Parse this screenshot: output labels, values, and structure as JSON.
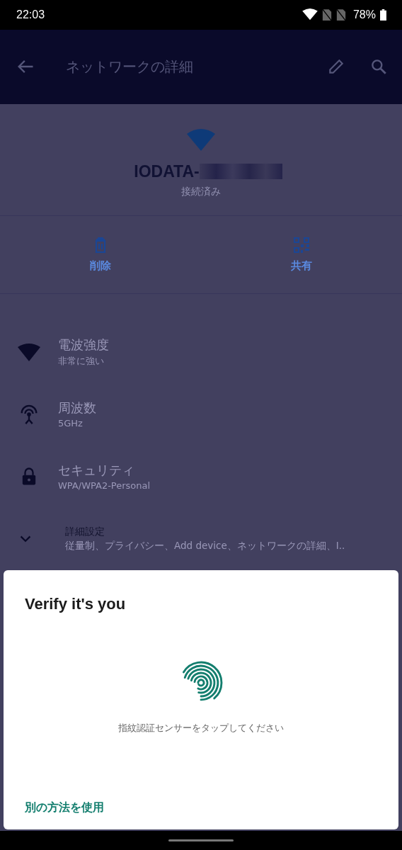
{
  "status_bar": {
    "time": "22:03",
    "battery": "78%"
  },
  "app_bar": {
    "title": "ネットワークの詳細"
  },
  "network": {
    "ssid": "IODATA-",
    "status": "接続済み"
  },
  "actions": [
    {
      "kind": "delete",
      "label": "削除"
    },
    {
      "kind": "share",
      "label": "共有"
    }
  ],
  "details": [
    {
      "kind": "signal",
      "title": "電波強度",
      "value": "非常に強い"
    },
    {
      "kind": "frequency",
      "title": "周波数",
      "value": "5GHz"
    },
    {
      "kind": "security",
      "title": "セキュリティ",
      "value": "WPA/WPA2-Personal"
    },
    {
      "kind": "advanced",
      "title": "詳細設定",
      "value": "従量制、プライバシー、Add device、ネットワークの詳細、I.."
    }
  ],
  "dialog": {
    "title": "Verify it's you",
    "message": "指紋認証センサーをタップしてください",
    "link": "別の方法を使用"
  }
}
